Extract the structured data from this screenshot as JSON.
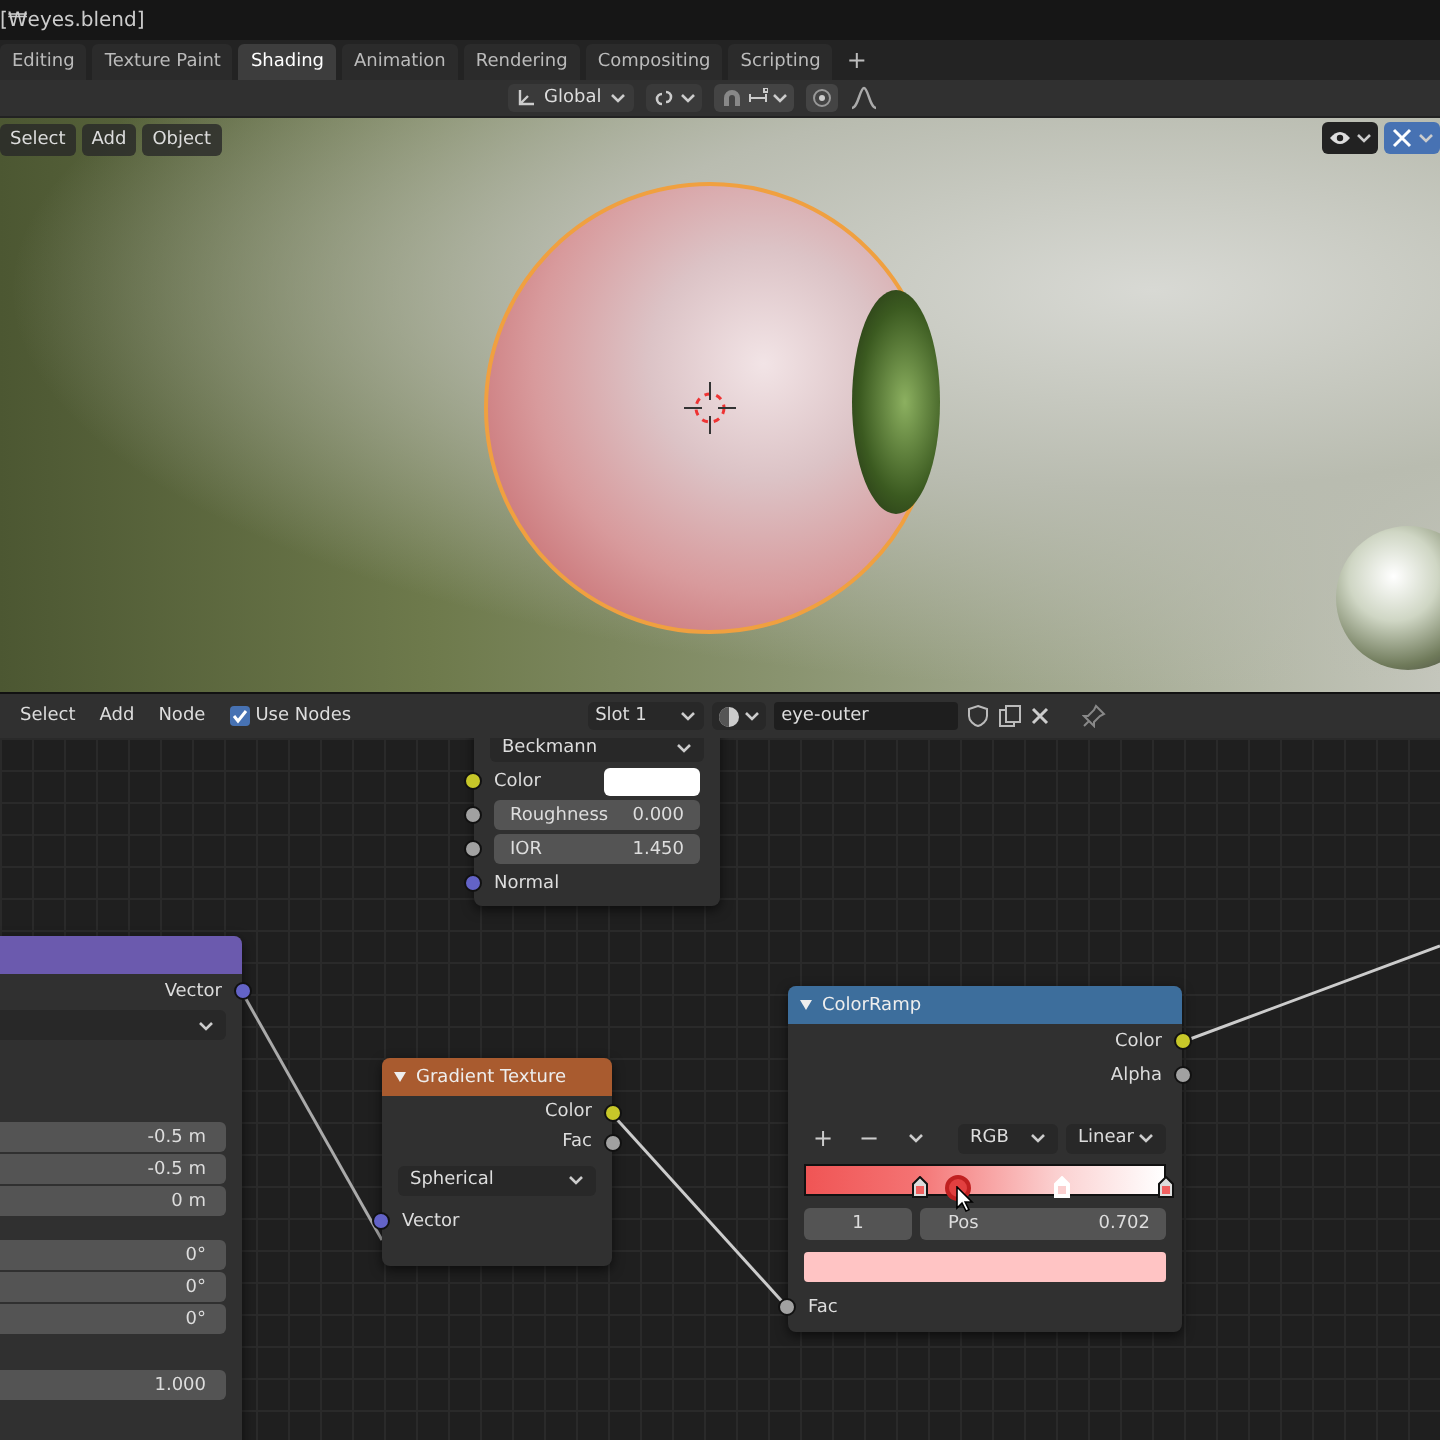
{
  "window": {
    "title": "[₩eyes.blend]"
  },
  "workspace_tabs": [
    {
      "label": "Editing",
      "selected": false
    },
    {
      "label": "Texture Paint",
      "selected": false
    },
    {
      "label": "Shading",
      "selected": true
    },
    {
      "label": "Animation",
      "selected": false
    },
    {
      "label": "Rendering",
      "selected": false
    },
    {
      "label": "Compositing",
      "selected": false
    },
    {
      "label": "Scripting",
      "selected": false
    }
  ],
  "add_workspace": "+",
  "viewport": {
    "orientation": "Global",
    "menus": [
      "Select",
      "Add",
      "Object"
    ]
  },
  "node_editor": {
    "menus": [
      "Select",
      "Add",
      "Node"
    ],
    "use_nodes": {
      "label": "Use Nodes",
      "checked": true
    },
    "slot": "Slot 1",
    "material": "eye-outer"
  },
  "nodes": [
    {
      "kind": "shader",
      "distribution": "Beckmann",
      "inputs": [
        {
          "label": "Color",
          "kind": "color"
        },
        {
          "label": "Roughness",
          "value": "0.000",
          "kind": "float"
        },
        {
          "label": "IOR",
          "value": "1.450",
          "kind": "float"
        },
        {
          "label": "Normal",
          "kind": "vector"
        }
      ]
    },
    {
      "kind": "mapping",
      "output": "Vector",
      "location": [
        "-0.5 m",
        "-0.5 m",
        "0 m"
      ],
      "rotation": [
        "0°",
        "0°",
        "0°"
      ],
      "scale": [
        "1.000"
      ]
    },
    {
      "kind": "gradient",
      "title": "Gradient Texture",
      "outputs": [
        {
          "label": "Color",
          "kind": "color"
        },
        {
          "label": "Fac",
          "kind": "float"
        }
      ],
      "type": "Spherical",
      "input": {
        "label": "Vector",
        "kind": "vector"
      }
    },
    {
      "kind": "colorramp",
      "title": "ColorRamp",
      "outputs": [
        {
          "label": "Color",
          "kind": "color"
        },
        {
          "label": "Alpha",
          "kind": "float"
        }
      ],
      "add": "+",
      "remove": "−",
      "mode": "RGB",
      "interpolation": "Linear",
      "stops": [
        {
          "level": 0.32,
          "selected": false
        },
        {
          "level": 0.71,
          "selected": true
        },
        {
          "level": 1.0,
          "selected": false
        }
      ],
      "index": "1",
      "pos_label": "Pos",
      "pos_value": "0.702",
      "input": {
        "label": "Fac",
        "kind": "float"
      }
    }
  ]
}
